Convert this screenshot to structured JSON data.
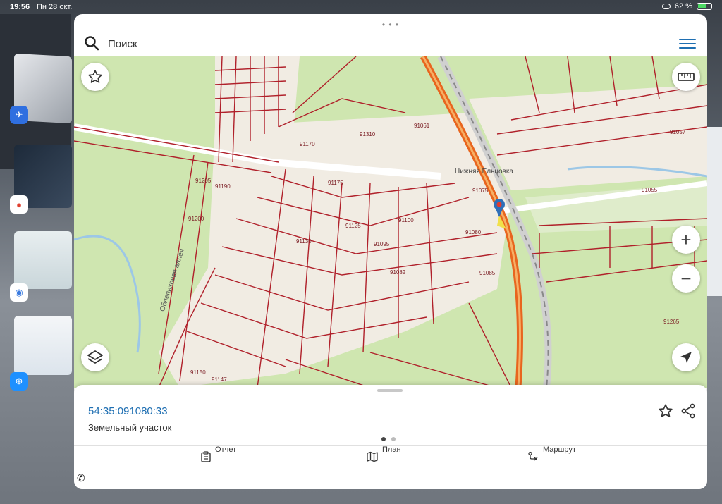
{
  "status_bar": {
    "time": "19:56",
    "date": "Пн 28 окт.",
    "battery": "62 %",
    "battery_level": 0.62
  },
  "search": {
    "placeholder": "Поиск"
  },
  "map_labels": {
    "place": "Нижняя Ельцовка",
    "street": "Облепиховая аллея",
    "parcels": [
      "91310",
      "91075",
      "91080",
      "91085",
      "91100",
      "91205",
      "91200",
      "91190",
      "91175",
      "91170",
      "91125",
      "91130",
      "91095",
      "91082",
      "91150",
      "91147",
      "91055",
      "91057",
      "91061",
      "91265"
    ]
  },
  "map_controls": {
    "favorite": "star-icon",
    "ruler": "ruler-icon",
    "zoom_in": "+",
    "zoom_out": "−",
    "layers": "layers-icon",
    "locate": "navigation-arrow-icon"
  },
  "sheet": {
    "cadastral_number": "54:35:091080:33",
    "object_type": "Земельный участок",
    "page_count": 2,
    "active_page": 1
  },
  "tabs": [
    {
      "label": "Отчет",
      "icon": "clipboard-icon"
    },
    {
      "label": "План",
      "icon": "map-icon"
    },
    {
      "label": "Маршрут",
      "icon": "route-icon"
    }
  ],
  "colors": {
    "accent": "#1f6fb2",
    "parcel_border": "#b0202a",
    "highway": "#e8651e",
    "map_green": "#cfe6b0",
    "map_beige": "#f1ece3"
  }
}
